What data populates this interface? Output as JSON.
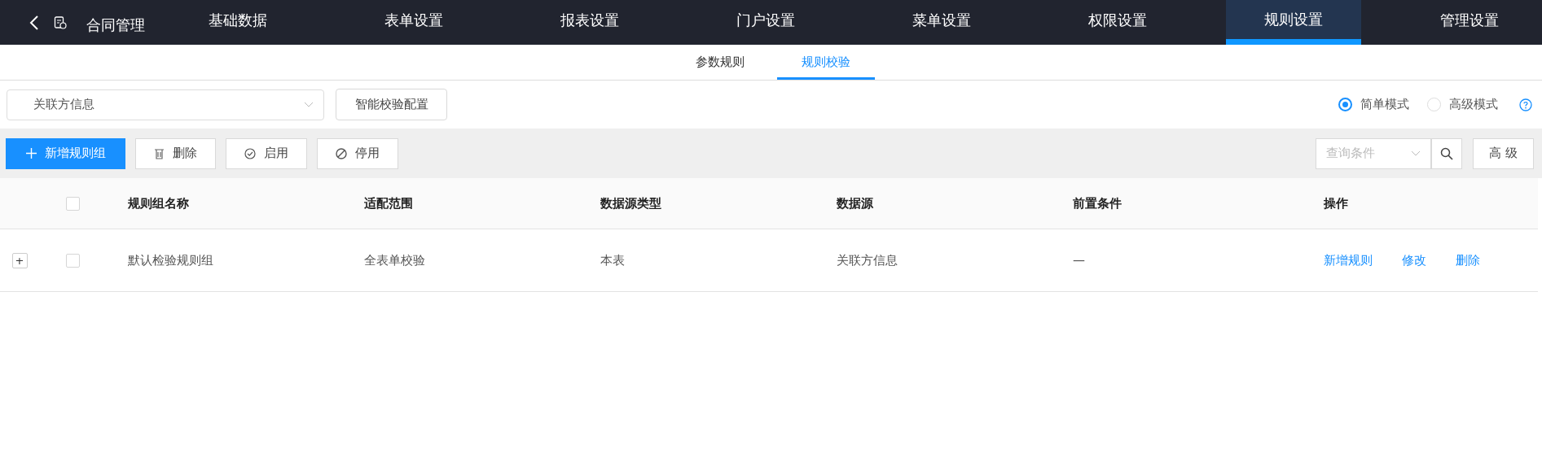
{
  "header": {
    "title": "合同管理"
  },
  "nav": [
    {
      "label": "基础数据",
      "selected": false
    },
    {
      "label": "表单设置",
      "selected": false
    },
    {
      "label": "报表设置",
      "selected": false
    },
    {
      "label": "门户设置",
      "selected": false
    },
    {
      "label": "菜单设置",
      "selected": false
    },
    {
      "label": "权限设置",
      "selected": false
    },
    {
      "label": "规则设置",
      "selected": true
    },
    {
      "label": "管理设置",
      "selected": false
    }
  ],
  "subtabs": [
    {
      "label": "参数规则",
      "selected": false
    },
    {
      "label": "规则校验",
      "selected": true
    }
  ],
  "filter": {
    "select_value": "关联方信息",
    "config_button": "智能校验配置"
  },
  "modes": [
    {
      "label": "简单模式",
      "selected": true
    },
    {
      "label": "高级模式",
      "selected": false
    }
  ],
  "toolbar": {
    "buttons": [
      {
        "kind": "add",
        "label": "新增规则组"
      },
      {
        "kind": "delete",
        "label": "删除"
      },
      {
        "kind": "enable",
        "label": "启用"
      },
      {
        "kind": "disable",
        "label": "停用"
      }
    ],
    "search_placeholder": "查询条件",
    "advanced": "高 级"
  },
  "table": {
    "header_checked": false,
    "columns": [
      "规则组名称",
      "适配范围",
      "数据源类型",
      "数据源",
      "前置条件",
      "操作"
    ],
    "rows": [
      {
        "expander": "+",
        "checked": false,
        "cells": [
          "默认检验规则组",
          "全表单校验",
          "本表",
          "关联方信息",
          "—"
        ],
        "actions": [
          "新增规则",
          "修改",
          "删除"
        ]
      }
    ]
  }
}
